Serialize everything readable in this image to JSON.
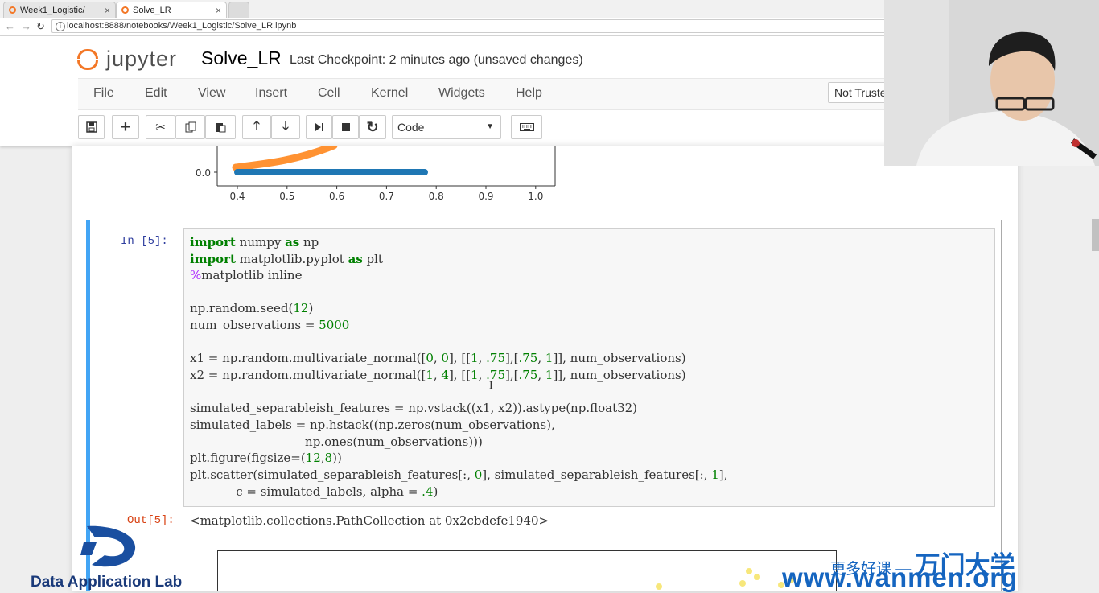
{
  "browser": {
    "tabs": [
      {
        "label": "Week1_Logistic/",
        "close": "×"
      },
      {
        "label": "Solve_LR",
        "close": "×"
      }
    ],
    "url": "localhost:8888/notebooks/Week1_Logistic/Solve_LR.ipynb",
    "info_icon": "i"
  },
  "header": {
    "brand": "jupyter",
    "notebook_title": "Solve_LR",
    "checkpoint": "Last Checkpoint: 2 minutes ago (unsaved changes)",
    "trust_label": "Not Trusted"
  },
  "menu": [
    "File",
    "Edit",
    "View",
    "Insert",
    "Cell",
    "Kernel",
    "Widgets",
    "Help"
  ],
  "toolbar": {
    "cell_type": "Code",
    "icons": [
      "save-icon",
      "plus-icon",
      "cut-icon",
      "copy-icon",
      "paste-icon",
      "arrow-up-icon",
      "arrow-down-icon",
      "run-icon",
      "stop-icon",
      "restart-icon",
      "keyboard-icon"
    ]
  },
  "top_plot": {
    "y_tick": "0.0",
    "x_ticks": [
      "0.4",
      "0.5",
      "0.6",
      "0.7",
      "0.8",
      "0.9",
      "1.0"
    ],
    "colors": {
      "series0": "#1f77b4",
      "series1": "#ff7f0e"
    }
  },
  "cell": {
    "in_prompt": "In  [5]:",
    "out_prompt": "Out[5]:",
    "output_text": "<matplotlib.collections.PathCollection at 0x2cbdefe1940>",
    "code": [
      "import numpy as np",
      "import matplotlib.pyplot as plt",
      "%matplotlib inline",
      "",
      "np.random.seed(12)",
      "num_observations = 5000",
      "",
      "x1 = np.random.multivariate_normal([0, 0], [[1, .75],[.75, 1]], num_observations)",
      "x2 = np.random.multivariate_normal([1, 4], [[1, .75],[.75, 1]], num_observations)",
      "",
      "simulated_separableish_features = np.vstack((x1, x2)).astype(np.float32)",
      "simulated_labels = np.hstack((np.zeros(num_observations),",
      "                              np.ones(num_observations)))",
      "plt.figure(figsize=(12,8))",
      "plt.scatter(simulated_separableish_features[:, 0], simulated_separableish_features[:, 1],",
      "            c = simulated_labels, alpha = .4)"
    ]
  },
  "watermark": {
    "lab_name": "Data Application Lab",
    "cn_prefix": "更多好课 —",
    "cn_brand": "万门大学",
    "url": "www.wanmen.org"
  },
  "accent_color": "#42a5f5"
}
